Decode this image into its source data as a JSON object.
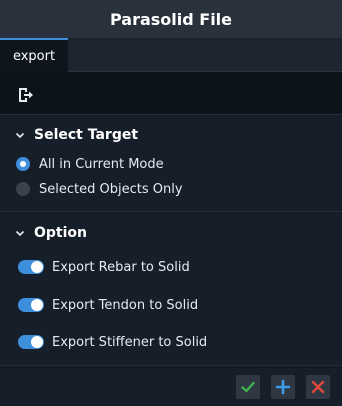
{
  "window": {
    "title": "Parasolid File"
  },
  "tabs": [
    {
      "label": "export",
      "active": true
    }
  ],
  "toolbar": {
    "export_icon": "export-icon"
  },
  "select_target": {
    "header": "Select Target",
    "options": [
      {
        "label": "All in Current Mode",
        "selected": true
      },
      {
        "label": "Selected Objects Only",
        "selected": false
      }
    ]
  },
  "option": {
    "header": "Option",
    "toggles": [
      {
        "label": "Export Rebar to Solid",
        "on": true
      },
      {
        "label": "Export Tendon to Solid",
        "on": true
      },
      {
        "label": "Export Stiffener to Solid",
        "on": true
      }
    ]
  },
  "footer": {
    "ok_icon": "check-icon",
    "add_icon": "plus-icon",
    "close_icon": "close-icon"
  },
  "colors": {
    "accent": "#3d8fdc",
    "ok": "#3fb34f",
    "add": "#3d9be9",
    "close": "#e04a3c"
  }
}
